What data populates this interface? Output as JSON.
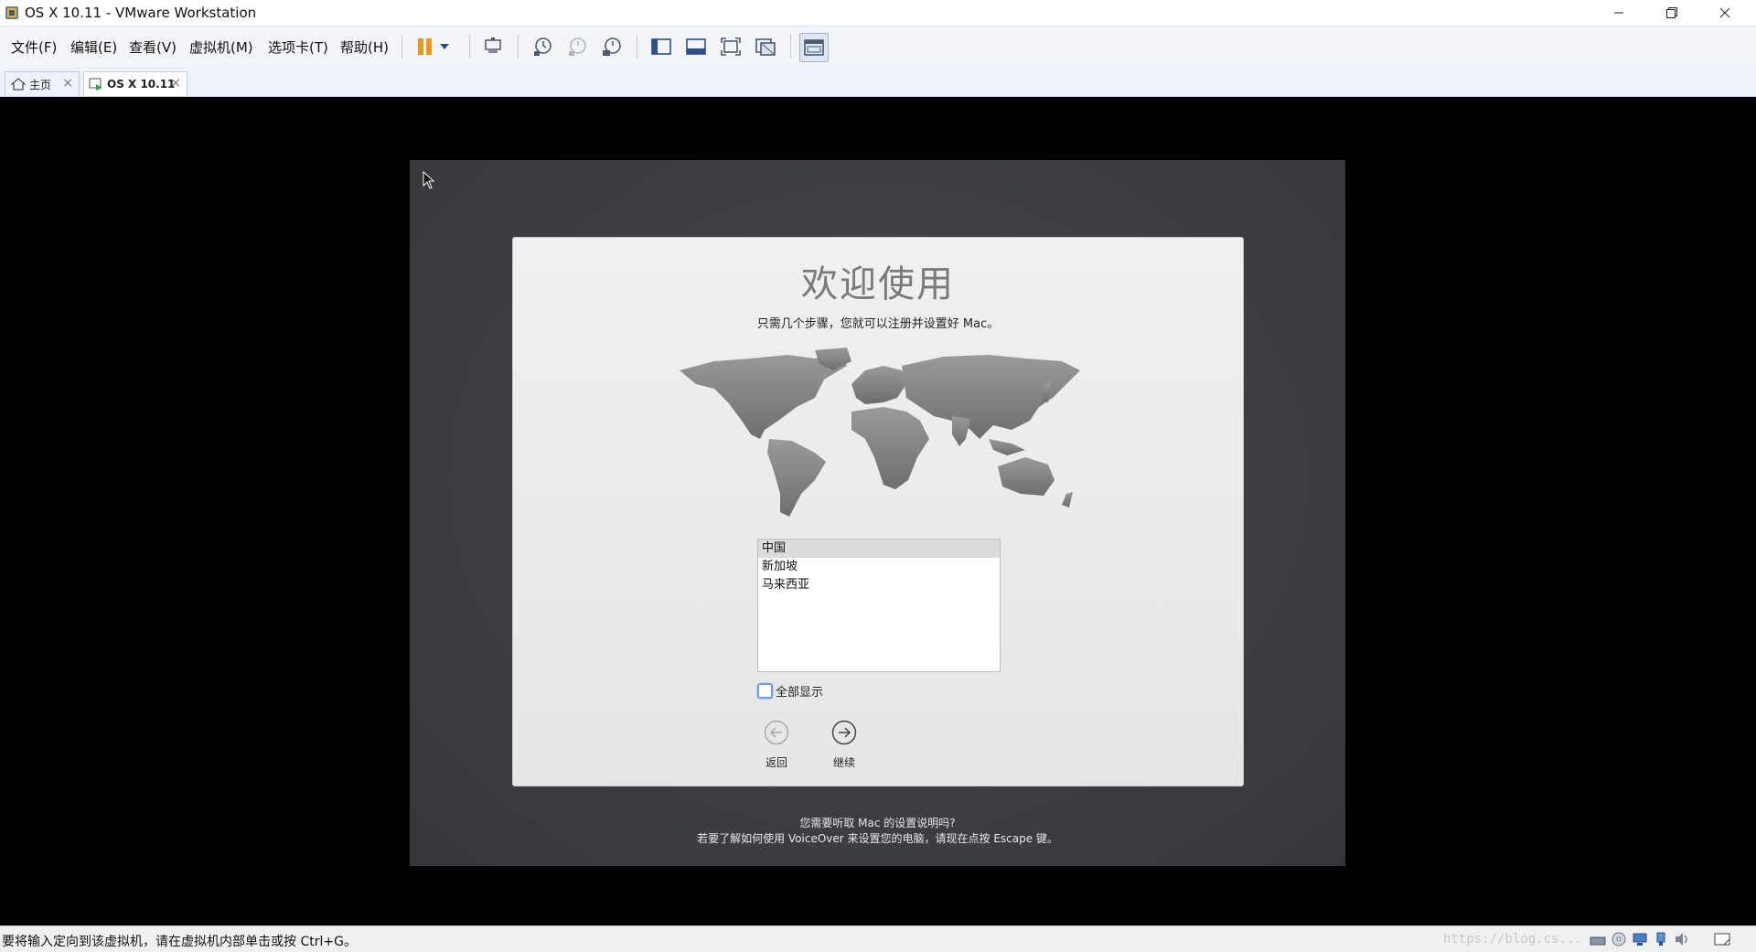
{
  "window": {
    "title": "OS X 10.11 - VMware Workstation",
    "app_icon": "vmware-icon",
    "controls": [
      "minimize-icon",
      "restore-icon",
      "close-icon"
    ]
  },
  "menu": {
    "items": [
      {
        "label": "文件(F)"
      },
      {
        "label": "编辑(E)"
      },
      {
        "label": "查看(V)"
      },
      {
        "label": "虚拟机(M)"
      },
      {
        "label": "选项卡(T)"
      },
      {
        "label": "帮助(H)"
      }
    ]
  },
  "toolbar": {
    "icons": [
      "pause-icon",
      "dropdown-arrow-icon",
      "send-ctrl-alt-del-icon",
      "snapshot-icon",
      "revert-snapshot-icon",
      "snapshot-manager-icon",
      "library-icon",
      "console-view-icon",
      "fullscreen-icon",
      "unity-icon",
      "thumbnail-view-icon"
    ]
  },
  "tabs": [
    {
      "label": "主页",
      "icon": "home-icon",
      "active": false
    },
    {
      "label": "OS X 10.11",
      "icon": "vm-icon",
      "active": true
    }
  ],
  "setup": {
    "title": "欢迎使用",
    "subtitle": "只需几个步骤，您就可以注册并设置好 Mac。",
    "countries": [
      {
        "name": "中国",
        "selected": true
      },
      {
        "name": "新加坡",
        "selected": false
      },
      {
        "name": "马来西亚",
        "selected": false
      }
    ],
    "show_all_label": "全部显示",
    "show_all_checked": false,
    "back_label": "返回",
    "continue_label": "继续",
    "voiceover_line1": "您需要听取 Mac 的设置说明吗?",
    "voiceover_line2": "若要了解如何使用 VoiceOver 来设置您的电脑，请现在点按 Escape 键。"
  },
  "statusbar": {
    "text": "要将输入定向到该虚拟机，请在虚拟机内部单击或按 Ctrl+G。",
    "watermark": "https://blog.cs...",
    "icons": [
      "hard-disk-icon",
      "cd-icon",
      "network-icon",
      "usb-icon",
      "sound-icon",
      "message-icon"
    ]
  },
  "colors": {
    "vm_background": "#000000",
    "mac_background": "#404146",
    "dialog_background": "#ececec",
    "accent_checkbox": "#6d9de6"
  }
}
